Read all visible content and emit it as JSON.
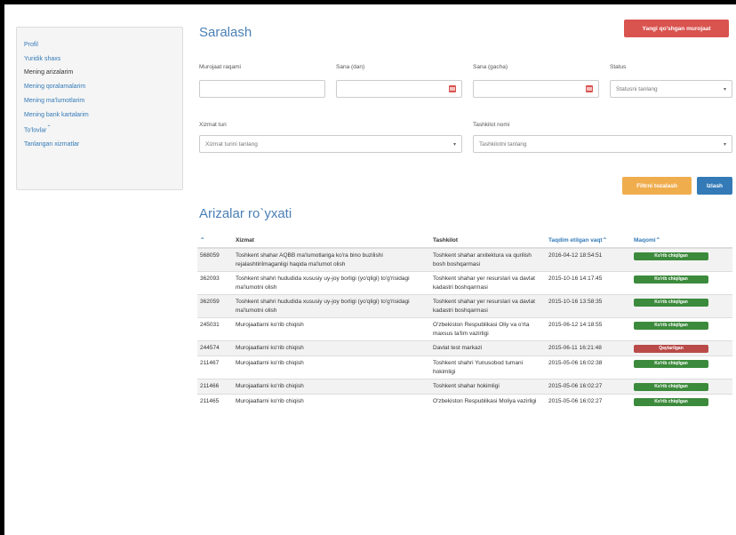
{
  "sidebar": {
    "items": [
      {
        "label": "Profil",
        "active": false
      },
      {
        "label": "Yuridik shaxs",
        "active": false
      },
      {
        "label": "Mening arizalarim",
        "active": true
      },
      {
        "label": "Mening qoralamalarim",
        "active": false
      },
      {
        "label": "Mening ma'lumotlarim",
        "active": false
      },
      {
        "label": "Mening bank kartalarim",
        "active": false
      },
      {
        "label": "To'lovlar",
        "active": false
      },
      {
        "label": "Tanlangan xizmatlar",
        "active": false
      }
    ]
  },
  "filter": {
    "title": "Saralash",
    "new_button": "Yangi qo'shgan murojaat",
    "murojaat_raqami_label": "Murojaat raqami",
    "sana_dan_label": "Sana (dan)",
    "sana_gacha_label": "Sana (gacha)",
    "status_label": "Status",
    "status_placeholder": "Statusni tanlang",
    "xizmat_turi_label": "Xizmat turi",
    "xizmat_placeholder": "Xizmat turini tanlang",
    "tashkilot_label": "Tashkilot nomi",
    "tashkilot_placeholder": "Tashkilotni tanlang",
    "reset_button": "Filtrni tozalash",
    "search_button": "Izlash"
  },
  "list": {
    "title": "Arizalar ro`yxati",
    "columns": [
      "",
      "Xizmat",
      "Tashkilot",
      "Taqdim etilgan vaqt",
      "Maqomi"
    ],
    "rows": [
      {
        "id": "568059",
        "xizmat": "Toshkent shahar AQBB ma'lumotlariga ko'ra bino buzilishi rejalashtirilmaganligi haqida ma'lumot olish",
        "tashkilot": "Toshkent shahar arxitektura va qurilish bosh boshqarmasi",
        "vaqt": "2016-04-12 18:54:51",
        "status": "Ko'rib chiqilgan",
        "status_color": "#3c8a3c"
      },
      {
        "id": "362093",
        "xizmat": "Toshkent shahri hududida xususiy uy-joy borligi (yo'qligi) to'g'risidagi ma'lumotni olish",
        "tashkilot": "Toshkent shahar yer resurslari va davlat kadastri boshqarmasi",
        "vaqt": "2015-10-16 14:17:45",
        "status": "Ko'rib chiqilgan",
        "status_color": "#3c8a3c"
      },
      {
        "id": "362059",
        "xizmat": "Toshkent shahri hududida xususiy uy-joy borligi (yo'qligi) to'g'risidagi ma'lumotni olish",
        "tashkilot": "Toshkent shahar yer resurslari va davlat kadastri boshqarmasi",
        "vaqt": "2015-10-16 13:58:35",
        "status": "Ko'rib chiqilgan",
        "status_color": "#3c8a3c"
      },
      {
        "id": "245031",
        "xizmat": "Murojaatlarni ko'rib chiqish",
        "tashkilot": "O'zbekiston Respublikasi Oliy va o'rta maxsus ta'lim vazirligi",
        "vaqt": "2015-06-12 14:18:55",
        "status": "Ko'rib chiqilgan",
        "status_color": "#3c8a3c"
      },
      {
        "id": "244574",
        "xizmat": "Murojaatlarni ko'rib chiqish",
        "tashkilot": "Davlat test markazi",
        "vaqt": "2015-06-11 16:21:48",
        "status": "Qaytarilgan",
        "status_color": "#b94a48"
      },
      {
        "id": "211467",
        "xizmat": "Murojaatlarni ko'rib chiqish",
        "tashkilot": "Toshkent shahri Yunusobod tumani hokimligi",
        "vaqt": "2015-05-06 16:02:38",
        "status": "Ko'rib chiqilgan",
        "status_color": "#3c8a3c"
      },
      {
        "id": "211466",
        "xizmat": "Murojaatlarni ko'rib chiqish",
        "tashkilot": "Toshkent shahar hokimligi",
        "vaqt": "2015-05-06 16:02:27",
        "status": "Ko'rib chiqilgan",
        "status_color": "#3c8a3c"
      },
      {
        "id": "211465",
        "xizmat": "Murojaatlarni ko'rib chiqish",
        "tashkilot": "O'zbekiston Respublikasi Moliya vazirligi",
        "vaqt": "2015-05-06 16:02:27",
        "status": "Ko'rib chiqilgan",
        "status_color": "#3c8a3c"
      }
    ]
  }
}
